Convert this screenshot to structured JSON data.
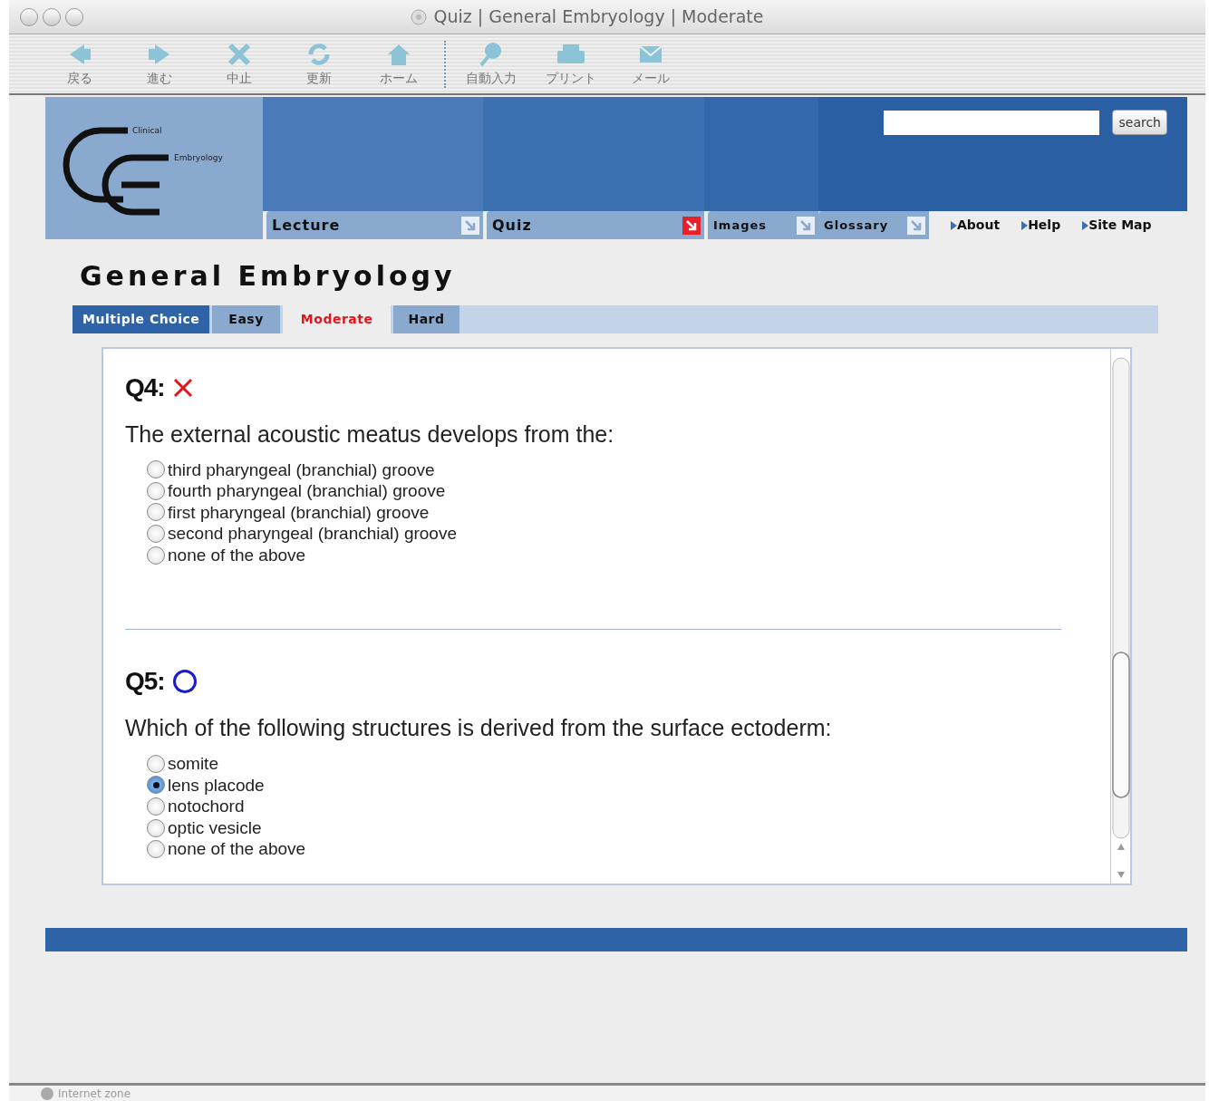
{
  "window": {
    "title": "Quiz | General Embryology | Moderate"
  },
  "toolbar": [
    {
      "label": "戻る"
    },
    {
      "label": "進む"
    },
    {
      "label": "中止"
    },
    {
      "label": "更新"
    },
    {
      "label": "ホーム"
    },
    {
      "label": "自動入力"
    },
    {
      "label": "プリント"
    },
    {
      "label": "メール"
    }
  ],
  "logo": {
    "line_1": "Clinical",
    "line_2": "Embryology"
  },
  "search": {
    "button": "search"
  },
  "nav_tabs": [
    {
      "label": "Lecture",
      "selected": false
    },
    {
      "label": "Quiz",
      "selected": true
    },
    {
      "label": "Images",
      "selected": false
    },
    {
      "label": "Glossary",
      "selected": false
    }
  ],
  "links": [
    "About",
    "Help",
    "Site Map"
  ],
  "page_title": "General Embryology",
  "subtabs": [
    {
      "label": "Multiple Choice",
      "kind": "category"
    },
    {
      "label": "Easy",
      "kind": "level",
      "selected": false
    },
    {
      "label": "Moderate",
      "kind": "level",
      "selected": true
    },
    {
      "label": "Hard",
      "kind": "level",
      "selected": false
    }
  ],
  "questions": [
    {
      "number": "Q4:",
      "correct": false,
      "text": "The external acoustic meatus develops from the:",
      "options": [
        {
          "label": "third pharyngeal (branchial) groove",
          "selected": false
        },
        {
          "label": "fourth pharyngeal (branchial) groove",
          "selected": false
        },
        {
          "label": "first pharyngeal (branchial) groove",
          "selected": false
        },
        {
          "label": "second pharyngeal (branchial) groove",
          "selected": false
        },
        {
          "label": "none of the above",
          "selected": false
        }
      ]
    },
    {
      "number": "Q5:",
      "correct": true,
      "text": "Which of the following structures is derived from the surface ectoderm:",
      "options": [
        {
          "label": "somite",
          "selected": false
        },
        {
          "label": "lens placode",
          "selected": true
        },
        {
          "label": "notochord",
          "selected": false
        },
        {
          "label": "optic vesicle",
          "selected": false
        },
        {
          "label": "none of the above",
          "selected": false
        }
      ]
    }
  ],
  "status_bar": "Internet zone"
}
